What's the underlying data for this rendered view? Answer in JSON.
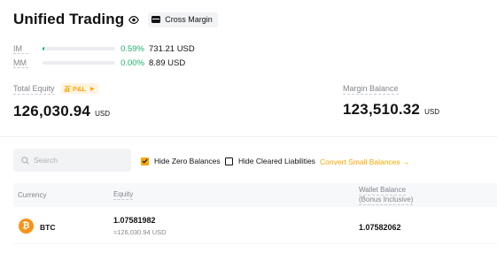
{
  "header": {
    "title": "Unified Trading",
    "margin_mode": "Cross Margin"
  },
  "ratios": [
    {
      "label": "IM",
      "percent": "0.59%",
      "value": "731.21 USD",
      "fill_fraction": 0.0059
    },
    {
      "label": "MM",
      "percent": "0.00%",
      "value": "8.89 USD",
      "fill_fraction": 0.0
    }
  ],
  "total_equity": {
    "label": "Total Equity",
    "pnl_badge": "P&L",
    "value": "126,030.94",
    "unit": "USD"
  },
  "margin_balance": {
    "label": "Margin Balance",
    "value": "123,510.32",
    "unit": "USD"
  },
  "filters": {
    "search_placeholder": "Search",
    "hide_zero_balances": {
      "label": "Hide Zero Balances",
      "checked": true
    },
    "hide_cleared_liabilities": {
      "label": "Hide Cleared Liabilities",
      "checked": false
    },
    "convert_link": "Convert Small Balances →"
  },
  "table": {
    "columns": {
      "currency": "Currency",
      "equity": "Equity",
      "wallet_balance_line1": "Wallet Balance",
      "wallet_balance_line2": "(Bonus Inclusive)"
    },
    "rows": [
      {
        "coin_symbol": "₿",
        "currency": "BTC",
        "equity": "1.07581982",
        "equity_usd": "≈126,030.94 USD",
        "wallet_balance": "1.07582062"
      }
    ]
  },
  "colors": {
    "accent": "#f7a600",
    "positive": "#20b26c",
    "btc": "#f7931a",
    "muted_text": "#81858c"
  }
}
